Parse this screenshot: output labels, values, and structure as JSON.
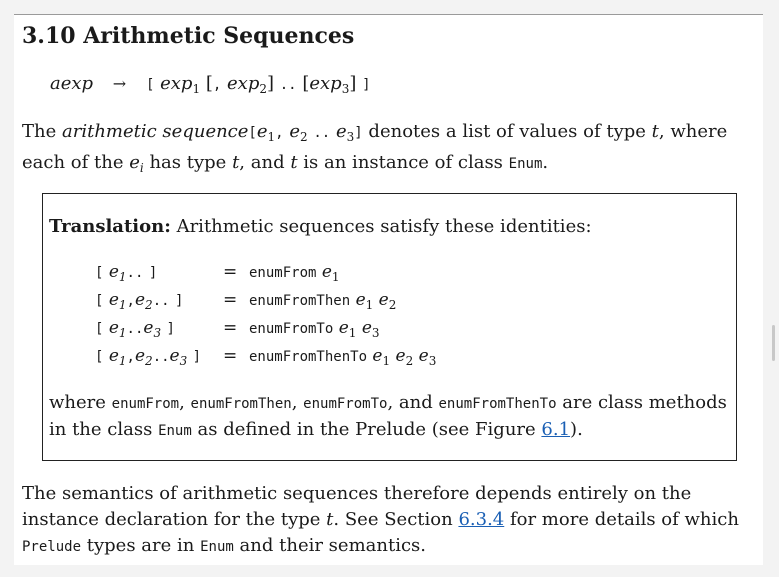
{
  "section_title": "3.10 Arithmetic Sequences",
  "syntax": {
    "lhs": "aexp",
    "open": "[",
    "exp": "exp",
    "bracket_open": "[",
    "comma": ",",
    "bracket_close": "]",
    "dots": "..",
    "paren_open": "[",
    "close": "]",
    "s1": "1",
    "s2": "2",
    "s3": "3"
  },
  "intro": {
    "the": "The",
    "term": "arithmetic sequence",
    "seq_open": "[",
    "e": "e",
    "sep1": ",",
    "dots": "..",
    "seq_close": "]",
    "mid": "denotes a list of values of type",
    "t": "t",
    "rest1": ", where each of the",
    "ei": "e",
    "i": "i",
    "rest2": "has type",
    "rest3": ", and",
    "rest4": "is an instance of class",
    "enum": "Enum",
    "period": "."
  },
  "translation": {
    "label": "Translation:",
    "text": "Arithmetic sequences satisfy these identities:",
    "rows": [
      {
        "lhs": "[ e1.. ]",
        "eq": "=",
        "fn": "enumFrom",
        "args": "e1"
      },
      {
        "lhs": "[ e1,e2.. ]",
        "eq": "=",
        "fn": "enumFromThen",
        "args": "e1 e2"
      },
      {
        "lhs": "[ e1..e3 ]",
        "eq": "=",
        "fn": "enumFromTo",
        "args": "e1 e3"
      },
      {
        "lhs": "[ e1,e2..e3 ]",
        "eq": "=",
        "fn": "enumFromThenTo",
        "args": "e1 e2 e3"
      }
    ],
    "tail": {
      "where": "where",
      "m1": "enumFrom",
      "m2": "enumFromThen",
      "m3": "enumFromTo",
      "and": "and",
      "m4": "enumFromThenTo",
      "rest": "are class methods in the class",
      "enum": "Enum",
      "rest2": "as defined in the Prelude (see Figure",
      "link": "6.1",
      "close": ")."
    }
  },
  "outro": {
    "text1": "The semantics of arithmetic sequences therefore depends entirely on the instance declaration for the type",
    "t": "t",
    "text2": ". See Section",
    "link": "6.3.4",
    "text3": "for more details of which",
    "prelude": "Prelude",
    "text4": "types are in",
    "enum": "Enum",
    "text5": "and their semantics."
  }
}
